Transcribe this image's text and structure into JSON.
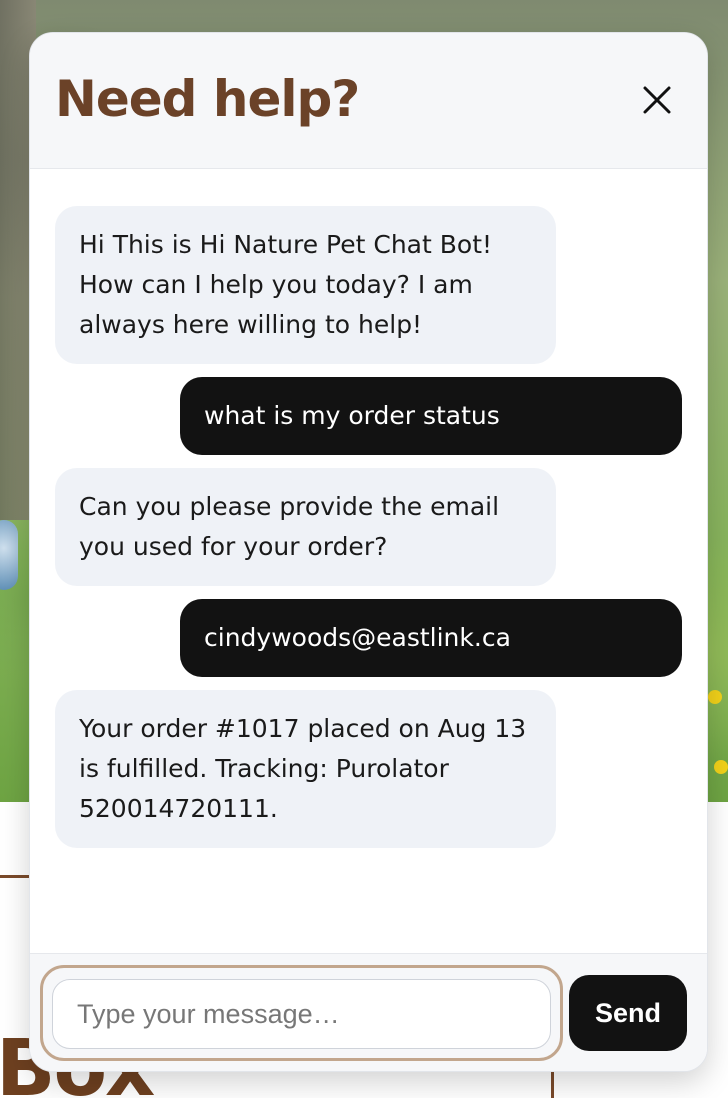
{
  "background": {
    "heading_fragment": "Box"
  },
  "chat": {
    "title": "Need help?",
    "close_icon": "close-icon",
    "messages": [
      {
        "role": "bot",
        "text": "Hi This is Hi Nature Pet Chat Bot! How can I help you today? I am always here willing to help!"
      },
      {
        "role": "user",
        "text": "what is my order status"
      },
      {
        "role": "bot",
        "text": "Can you please provide the email you used for your order?"
      },
      {
        "role": "user",
        "text": "cindywoods@eastlink.ca"
      },
      {
        "role": "bot",
        "text": "Your order #1017 placed on Aug 13 is fulfilled. Tracking: Purolator 520014720111."
      }
    ],
    "input": {
      "placeholder": "Type your message…",
      "value": ""
    },
    "send_label": "Send"
  },
  "colors": {
    "title": "#6b4228",
    "bot_bubble": "#eff2f7",
    "user_bubble": "#121212",
    "input_ring": "#c2a68d"
  }
}
